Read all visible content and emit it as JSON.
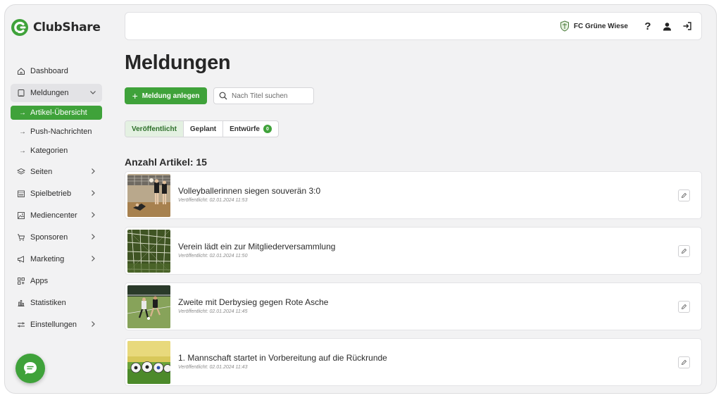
{
  "app": {
    "name": "ClubShare"
  },
  "club": {
    "name": "FC Grüne Wiese"
  },
  "sidebar": {
    "items": [
      {
        "label": "Dashboard",
        "icon": "home-icon"
      },
      {
        "label": "Meldungen",
        "icon": "document-icon",
        "open": true,
        "subitems": [
          {
            "label": "Artikel-Übersicht",
            "active": true
          },
          {
            "label": "Push-Nachrichten"
          },
          {
            "label": "Kategorien"
          }
        ]
      },
      {
        "label": "Seiten",
        "icon": "layers-icon"
      },
      {
        "label": "Spielbetrieb",
        "icon": "calendar-icon"
      },
      {
        "label": "Mediencenter",
        "icon": "image-icon"
      },
      {
        "label": "Sponsoren",
        "icon": "cart-icon"
      },
      {
        "label": "Marketing",
        "icon": "megaphone-icon"
      },
      {
        "label": "Apps",
        "icon": "apps-icon"
      },
      {
        "label": "Statistiken",
        "icon": "bar-chart-icon"
      },
      {
        "label": "Einstellungen",
        "icon": "sliders-icon"
      }
    ]
  },
  "main": {
    "title": "Meldungen",
    "create_label": "Meldung anlegen",
    "search_placeholder": "Nach Titel suchen",
    "tabs": [
      {
        "label": "Veröffentlicht",
        "active": true
      },
      {
        "label": "Geplant"
      },
      {
        "label": "Entwürfe",
        "badge": "0"
      }
    ],
    "count_label": "Anzahl Artikel: 15",
    "articles": [
      {
        "title": "Volleyballerinnen siegen souverän 3:0",
        "meta": "Veröffentlicht: 02.01.2024 11:53",
        "thumb": "volleyball"
      },
      {
        "title": "Verein lädt ein zur Mitgliederversammlung",
        "meta": "Veröffentlicht: 02.01.2024 11:50",
        "thumb": "goal-net"
      },
      {
        "title": "Zweite mit Derbysieg gegen Rote Asche",
        "meta": "Veröffentlicht: 02.01.2024 11:45",
        "thumb": "football-players"
      },
      {
        "title": "1. Mannschaft startet in Vorbereitung auf die Rückrunde",
        "meta": "Veröffentlicht: 02.01.2024 11:43",
        "thumb": "footballs"
      }
    ]
  },
  "colors": {
    "accent": "#3fa23a",
    "background": "#f2f2f3"
  }
}
